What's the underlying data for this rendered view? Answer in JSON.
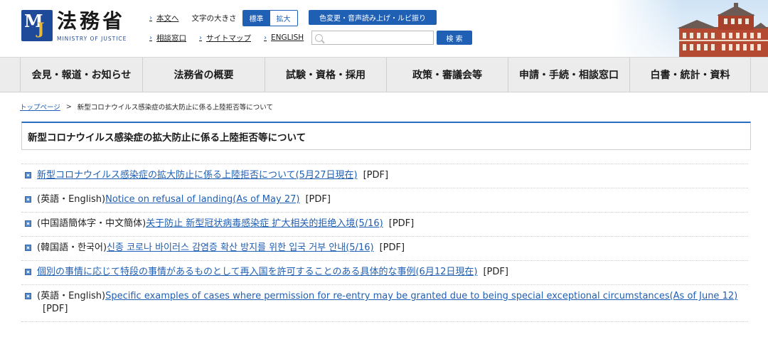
{
  "header": {
    "logo_jp": "法務省",
    "logo_en": "MINISTRY OF JUSTICE",
    "logo_mark_m": "M",
    "logo_mark_j": "J",
    "skip_link": "本文へ",
    "font_size_label": "文字の大きさ",
    "font_size_standard": "標準",
    "font_size_large": "拡大",
    "accessibility_button": "色変更・音声読み上げ・ルビ振り",
    "consult_link": "相談窓口",
    "sitemap_link": "サイトマップ",
    "english_link": "ENGLISH",
    "search_placeholder": "",
    "search_button": "検 索"
  },
  "nav": {
    "items": [
      {
        "label": "会見・報道・お知らせ"
      },
      {
        "label": "法務省の概要"
      },
      {
        "label": "試験・資格・採用"
      },
      {
        "label": "政策・審議会等"
      },
      {
        "label": "申請・手続・相談窓口"
      },
      {
        "label": "白書・統計・資料"
      }
    ]
  },
  "breadcrumb": {
    "home": "トップページ",
    "separator": ">",
    "current": "新型コロナウイルス感染症の拡大防止に係る上陸拒否等について"
  },
  "page_title": "新型コロナウイルス感染症の拡大防止に係る上陸拒否等について",
  "documents": [
    {
      "prefix": "",
      "link": "新型コロナウイルス感染症の拡大防止に係る上陸拒否について(5月27日現在)",
      "pdf": "[PDF]"
    },
    {
      "prefix": "(英語・English)",
      "link": "Notice on refusal of landing(As of May 27)",
      "pdf": "[PDF]"
    },
    {
      "prefix": "(中国語簡体字・中文簡体)",
      "link": "关于防止 新型冠状病毒感染症 扩大相关的拒绝入境(5/16)",
      "pdf": "[PDF]"
    },
    {
      "prefix": "(韓国語・한국어)",
      "link": "신종 코로나 바이러스 감염증 확산 방지를 위한 입국 거부 안내(5/16)",
      "pdf": "[PDF]"
    },
    {
      "prefix": "",
      "link": "個別の事情に応じて特段の事情があるものとして再入国を許可することのある具体的な事例(6月12日現在)",
      "pdf": "[PDF]"
    },
    {
      "prefix": "(英語・English)",
      "link": "Specific examples of cases where permission for re-entry may be granted due to being special exceptional circumstances(As of June 12)",
      "pdf": "[PDF]"
    }
  ],
  "icons": {
    "chevron": "chevron-right-icon",
    "bullet": "square-bullet-icon",
    "search": "search-icon"
  },
  "colors": {
    "accent": "#1f5fb4",
    "nav_bg": "#ececec",
    "link": "#1f5fb4"
  }
}
